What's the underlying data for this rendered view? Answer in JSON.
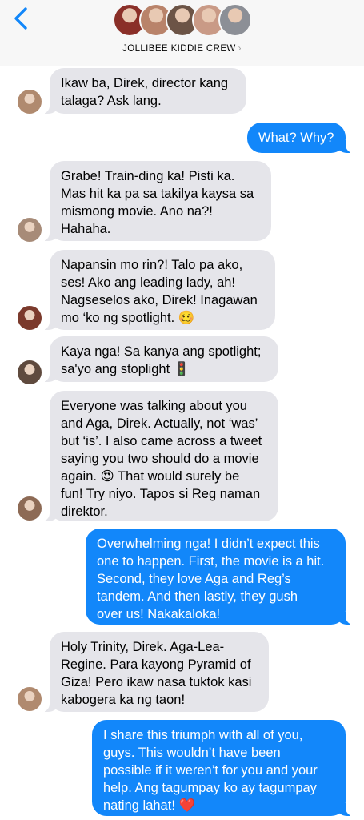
{
  "header": {
    "group_name": "JOLLIBEE KIDDIE CREW",
    "chevron": "›",
    "back_icon": "chevron-left-icon",
    "accent_color": "#1287fa",
    "avatar_colors": [
      "#8a2f28",
      "#b9836a",
      "#6c5446",
      "#c99a86",
      "#8c8f96"
    ]
  },
  "messages": [
    {
      "id": "m1",
      "dir": "in",
      "text": "Ikaw ba, Direk, director kang\ntalaga? Ask lang.",
      "avatar_color": "#b08a6f"
    },
    {
      "id": "m2",
      "dir": "out",
      "text": "What? Why?"
    },
    {
      "id": "m3",
      "dir": "in",
      "text": "Grabe! Train-ding ka! Pisti ka.\nMas hit ka pa sa takilya kaysa sa\nmismong movie. Ano na?!\nHahaha.",
      "avatar_color": "#a78b78"
    },
    {
      "id": "m4",
      "dir": "in",
      "text": "Napansin mo rin?! Talo pa ako,\nses! Ako ang leading lady, ah!\nNagseselos ako, Direk! Inagawan\nmo ‘ko ng spotlight. 🥴",
      "avatar_color": "#7b3a2c"
    },
    {
      "id": "m5",
      "dir": "in",
      "text": "Kaya nga! Sa kanya ang spotlight;\nsa'yo ang stoplight 🚦",
      "avatar_color": "#5f4a3e"
    },
    {
      "id": "m6",
      "dir": "in",
      "text": "Everyone was talking about you\nand Aga, Direk. Actually, not ‘was’\nbut ‘is’. I also came across a tweet\nsaying you two should do a movie\nagain. 😍 That would surely be\nfun! Try niyo. Tapos si Reg naman\ndirektor.",
      "avatar_color": "#8d6a55"
    },
    {
      "id": "m7",
      "dir": "out",
      "text": "Overwhelming nga! I didn’t expect this\none to happen. First, the movie is a hit.\nSecond, they love Aga and Reg’s\ntandem. And then lastly, they gush\nover us! Nakakaloka!"
    },
    {
      "id": "m8",
      "dir": "in",
      "text": "Holy Trinity, Direk. Aga-Lea-\nRegine. Para kayong Pyramid of\nGiza! Pero ikaw nasa tuktok kasi\nkabogera ka ng taon!",
      "avatar_color": "#b08a6f"
    },
    {
      "id": "m9",
      "dir": "out",
      "text": "I share this triumph with all of you,\nguys. This wouldn’t have been\npossible if it weren’t for you and your\nhelp. Ang tagumpay ko ay tagumpay\nnating lahat! ❤️"
    }
  ]
}
